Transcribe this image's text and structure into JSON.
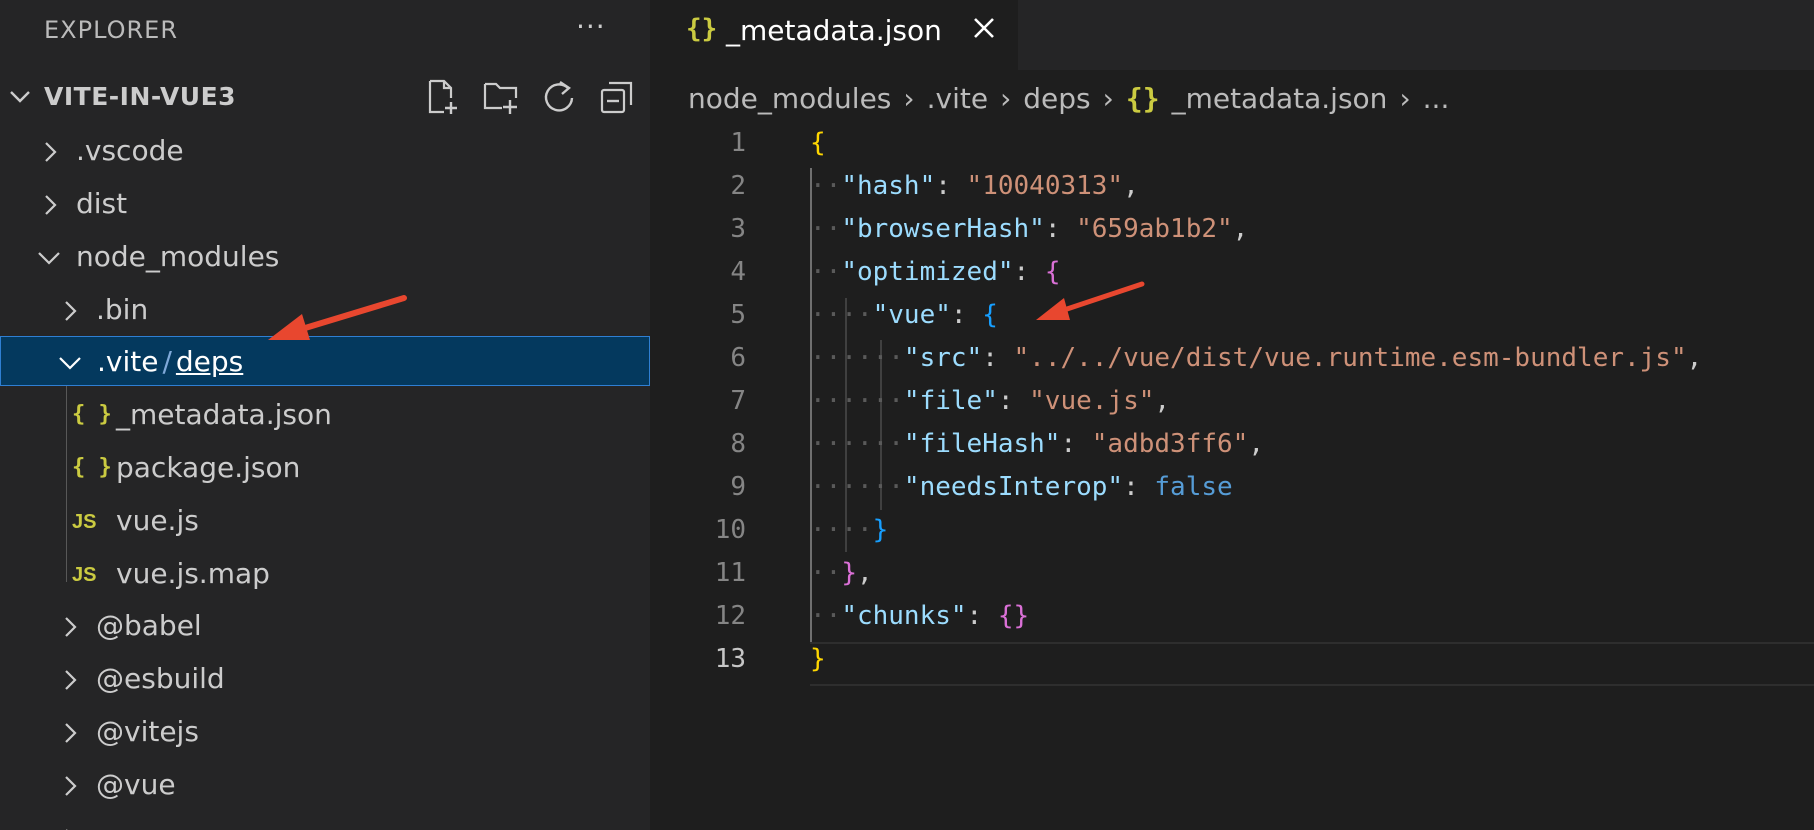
{
  "sidebar": {
    "title": "EXPLORER",
    "more_label": "···",
    "project": "VITE-IN-VUE3",
    "items": [
      {
        "label": ".vscode",
        "type": "folder",
        "expanded": false,
        "depth": 0
      },
      {
        "label": "dist",
        "type": "folder",
        "expanded": false,
        "depth": 0
      },
      {
        "label": "node_modules",
        "type": "folder",
        "expanded": true,
        "depth": 0
      },
      {
        "label": ".bin",
        "type": "folder",
        "expanded": false,
        "depth": 1
      },
      {
        "label_part1": ".vite",
        "label_sep": "/",
        "label_part2": "deps",
        "type": "folder",
        "expanded": true,
        "depth": 1,
        "selected": true
      },
      {
        "label": "_metadata.json",
        "type": "json",
        "icon": "{ }",
        "depth": 2
      },
      {
        "label": "package.json",
        "type": "json",
        "icon": "{ }",
        "depth": 2
      },
      {
        "label": "vue.js",
        "type": "js",
        "icon": "JS",
        "depth": 2
      },
      {
        "label": "vue.js.map",
        "type": "js",
        "icon": "JS",
        "depth": 2
      },
      {
        "label": "@babel",
        "type": "folder",
        "expanded": false,
        "depth": 1
      },
      {
        "label": "@esbuild",
        "type": "folder",
        "expanded": false,
        "depth": 1
      },
      {
        "label": "@vitejs",
        "type": "folder",
        "expanded": false,
        "depth": 1
      },
      {
        "label": "@vue",
        "type": "folder",
        "expanded": false,
        "depth": 1
      }
    ]
  },
  "tab": {
    "icon": "{}",
    "label": "_metadata.json"
  },
  "breadcrumb": {
    "parts": [
      "node_modules",
      ".vite",
      "deps"
    ],
    "file_icon": "{}",
    "file": "_metadata.json",
    "ellipsis": "..."
  },
  "code": {
    "line_numbers": [
      "1",
      "2",
      "3",
      "4",
      "5",
      "6",
      "7",
      "8",
      "9",
      "10",
      "11",
      "12",
      "13"
    ],
    "l2_key": "\"hash\"",
    "l2_val": "\"10040313\"",
    "l3_key": "\"browserHash\"",
    "l3_val": "\"659ab1b2\"",
    "l4_key": "\"optimized\"",
    "l5_key": "\"vue\"",
    "l6_key": "\"src\"",
    "l6_val": "\"../../vue/dist/vue.runtime.esm-bundler.js\"",
    "l7_key": "\"file\"",
    "l7_val": "\"vue.js\"",
    "l8_key": "\"fileHash\"",
    "l8_val": "\"adbd3ff6\"",
    "l9_key": "\"needsInterop\"",
    "l9_val": "false",
    "l12_key": "\"chunks\""
  },
  "colors": {
    "annotation_arrow": "#e8472f",
    "selection_bg": "#04395e",
    "json_icon": "#cbcb41"
  }
}
